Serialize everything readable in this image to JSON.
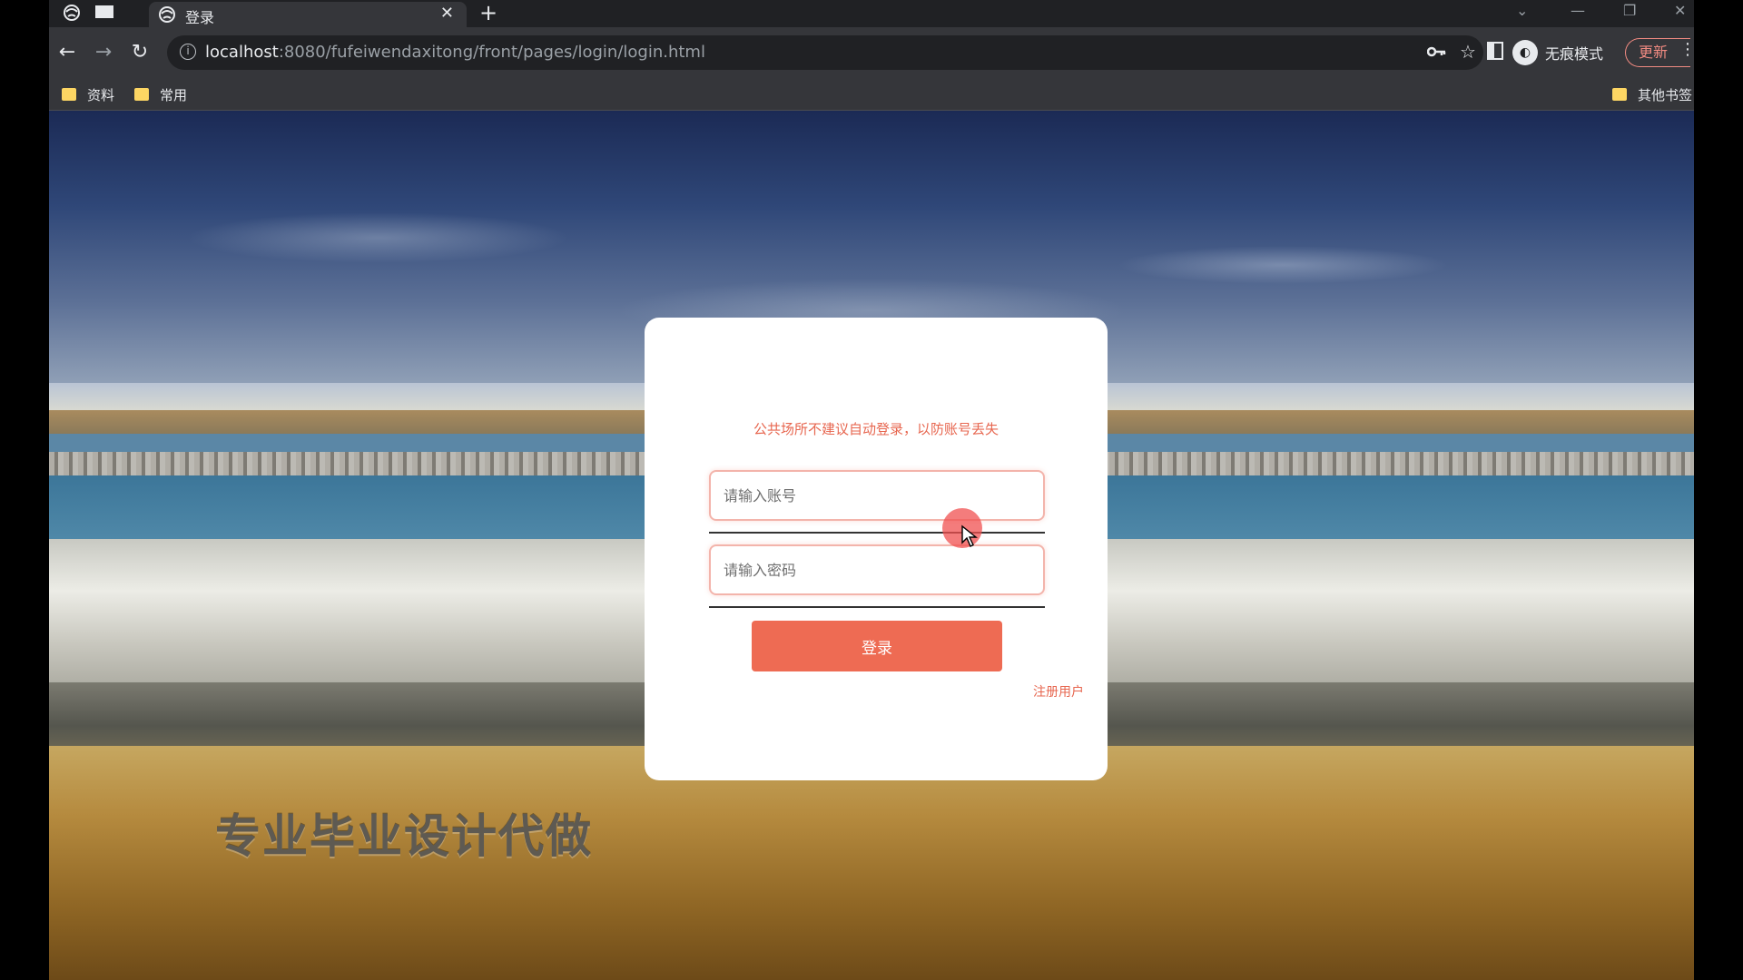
{
  "browser": {
    "tab_title": "登录",
    "url_host": "localhost",
    "url_rest": ":8080/fufeiwendaxitong/front/pages/login/login.html",
    "incognito_label": "无痕模式",
    "update_label": "更新",
    "bookmarks": [
      {
        "label": "资料"
      },
      {
        "label": "常用"
      }
    ],
    "other_bookmarks": "其他书签"
  },
  "login": {
    "notice": "公共场所不建议自动登录，以防账号丢失",
    "account_placeholder": "请输入账号",
    "password_placeholder": "请输入密码",
    "login_button": "登录",
    "register_link": "注册用户"
  },
  "watermark": "专业毕业设计代做",
  "colors": {
    "accent": "#ee6b53",
    "notice_text": "#e7664f",
    "folder": "#fdd663"
  }
}
